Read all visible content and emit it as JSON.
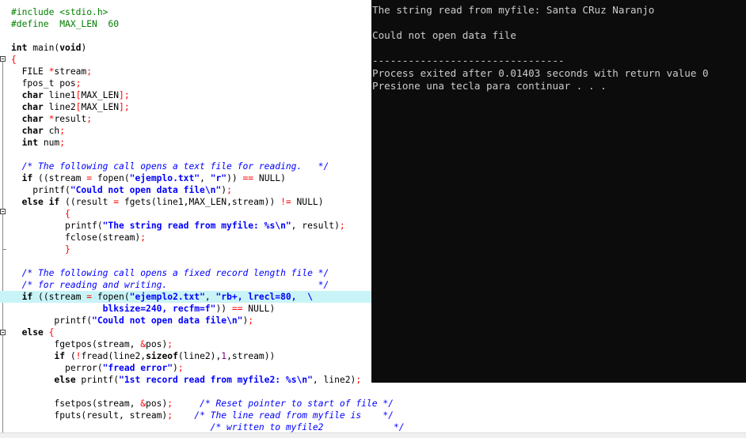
{
  "editor": {
    "lines": [
      [
        [
          "pp",
          "#include <stdio.h>"
        ]
      ],
      [
        [
          "pp",
          "#define  MAX_LEN  60"
        ]
      ],
      [
        [
          "t",
          ""
        ]
      ],
      [
        [
          "kw",
          "int"
        ],
        [
          "t",
          " main("
        ],
        [
          "kw",
          "void"
        ],
        [
          "t",
          ")"
        ]
      ],
      [
        [
          "op",
          "{"
        ]
      ],
      [
        [
          "t",
          "  FILE "
        ],
        [
          "op",
          "*"
        ],
        [
          "t",
          "stream"
        ],
        [
          "op",
          ";"
        ]
      ],
      [
        [
          "t",
          "  fpos_t pos"
        ],
        [
          "op",
          ";"
        ]
      ],
      [
        [
          "kw",
          "  char"
        ],
        [
          "t",
          " line1"
        ],
        [
          "op",
          "["
        ],
        [
          "t",
          "MAX_LEN"
        ],
        [
          "op",
          "];"
        ]
      ],
      [
        [
          "kw",
          "  char"
        ],
        [
          "t",
          " line2"
        ],
        [
          "op",
          "["
        ],
        [
          "t",
          "MAX_LEN"
        ],
        [
          "op",
          "];"
        ]
      ],
      [
        [
          "kw",
          "  char"
        ],
        [
          "t",
          " "
        ],
        [
          "op",
          "*"
        ],
        [
          "t",
          "result"
        ],
        [
          "op",
          ";"
        ]
      ],
      [
        [
          "kw",
          "  char"
        ],
        [
          "t",
          " ch"
        ],
        [
          "op",
          ";"
        ]
      ],
      [
        [
          "kw",
          "  int"
        ],
        [
          "t",
          " num"
        ],
        [
          "op",
          ";"
        ]
      ],
      [
        [
          "t",
          ""
        ]
      ],
      [
        [
          "cm",
          "  /* The following call opens a text file for reading.   */"
        ]
      ],
      [
        [
          "kw",
          "  if"
        ],
        [
          "t",
          " (("
        ],
        [
          "t",
          "stream "
        ],
        [
          "op",
          "="
        ],
        [
          "t",
          " fopen("
        ],
        [
          "str",
          "\"ejemplo.txt\""
        ],
        [
          "t",
          ", "
        ],
        [
          "str",
          "\"r\""
        ],
        [
          "t",
          ")) "
        ],
        [
          "op",
          "=="
        ],
        [
          "t",
          " NULL)"
        ]
      ],
      [
        [
          "t",
          "    printf("
        ],
        [
          "str",
          "\"Could not open data file\\n\""
        ],
        [
          "t",
          ")"
        ],
        [
          "op",
          ";"
        ]
      ],
      [
        [
          "kw",
          "  else if"
        ],
        [
          "t",
          " (("
        ],
        [
          "t",
          "result "
        ],
        [
          "op",
          "="
        ],
        [
          "t",
          " fgets(line1,MAX_LEN,stream)) "
        ],
        [
          "op",
          "!="
        ],
        [
          "t",
          " NULL)"
        ]
      ],
      [
        [
          "op",
          "          {"
        ]
      ],
      [
        [
          "t",
          "          printf("
        ],
        [
          "str",
          "\"The string read from myfile: %s\\n\""
        ],
        [
          "t",
          ", result)"
        ],
        [
          "op",
          ";"
        ]
      ],
      [
        [
          "t",
          "          fclose(stream)"
        ],
        [
          "op",
          ";"
        ]
      ],
      [
        [
          "op",
          "          }"
        ]
      ],
      [
        [
          "t",
          ""
        ]
      ],
      [
        [
          "cm",
          "  /* The following call opens a fixed record length file */"
        ]
      ],
      [
        [
          "cm",
          "  /* for reading and writing.                            */"
        ]
      ],
      [
        [
          "kw",
          "  if"
        ],
        [
          "t",
          " (("
        ],
        [
          "t",
          "stream "
        ],
        [
          "op",
          "="
        ],
        [
          "t",
          " fopen("
        ],
        [
          "str",
          "\"ejemplo2.txt\""
        ],
        [
          "t",
          ", "
        ],
        [
          "str",
          "\"rb+, lrecl=80,  \\"
        ]
      ],
      [
        [
          "str",
          "                 blksize=240, recfm=f\""
        ],
        [
          "t",
          ")) "
        ],
        [
          "op",
          "=="
        ],
        [
          "t",
          " NULL)"
        ]
      ],
      [
        [
          "t",
          "        printf("
        ],
        [
          "str",
          "\"Could not open data file\\n\""
        ],
        [
          "t",
          ")"
        ],
        [
          "op",
          ";"
        ]
      ],
      [
        [
          "kw",
          "  else"
        ],
        [
          "t",
          " "
        ],
        [
          "op",
          "{"
        ]
      ],
      [
        [
          "t",
          "        fgetpos(stream, "
        ],
        [
          "op",
          "&"
        ],
        [
          "t",
          "pos)"
        ],
        [
          "op",
          ";"
        ]
      ],
      [
        [
          "kw",
          "        if"
        ],
        [
          "t",
          " ("
        ],
        [
          "op",
          "!"
        ],
        [
          "t",
          "fread(line2,"
        ],
        [
          "kw",
          "sizeof"
        ],
        [
          "t",
          "(line2),"
        ],
        [
          "num",
          "1"
        ],
        [
          "t",
          ",stream))"
        ]
      ],
      [
        [
          "t",
          "          perror("
        ],
        [
          "str",
          "\"fread error\""
        ],
        [
          "t",
          ")"
        ],
        [
          "op",
          ";"
        ]
      ],
      [
        [
          "kw",
          "        else"
        ],
        [
          "t",
          " printf("
        ],
        [
          "str",
          "\"1st record read from myfile2: %s\\n\""
        ],
        [
          "t",
          ", line2)"
        ],
        [
          "op",
          ";"
        ]
      ],
      [
        [
          "t",
          ""
        ]
      ],
      [
        [
          "t",
          "        fsetpos(stream, "
        ],
        [
          "op",
          "&"
        ],
        [
          "t",
          "pos)"
        ],
        [
          "op",
          ";"
        ],
        [
          "t",
          "     "
        ],
        [
          "cm",
          "/* Reset pointer to start of file */"
        ]
      ],
      [
        [
          "t",
          "        fputs(result, stream)"
        ],
        [
          "op",
          ";"
        ],
        [
          "t",
          "    "
        ],
        [
          "cm",
          "/* The line read from myfile is    */"
        ]
      ],
      [
        [
          "t",
          "                                     "
        ],
        [
          "cm",
          "/* written to myfile2             */"
        ]
      ]
    ],
    "highlighted_line": 24
  },
  "console": {
    "lines": [
      "The string read from myfile: Santa CRuz Naranjo",
      "",
      "Could not open data file",
      "",
      "--------------------------------",
      "Process exited after 0.01403 seconds with return value 0",
      "Presione una tecla para continuar . . ."
    ]
  }
}
